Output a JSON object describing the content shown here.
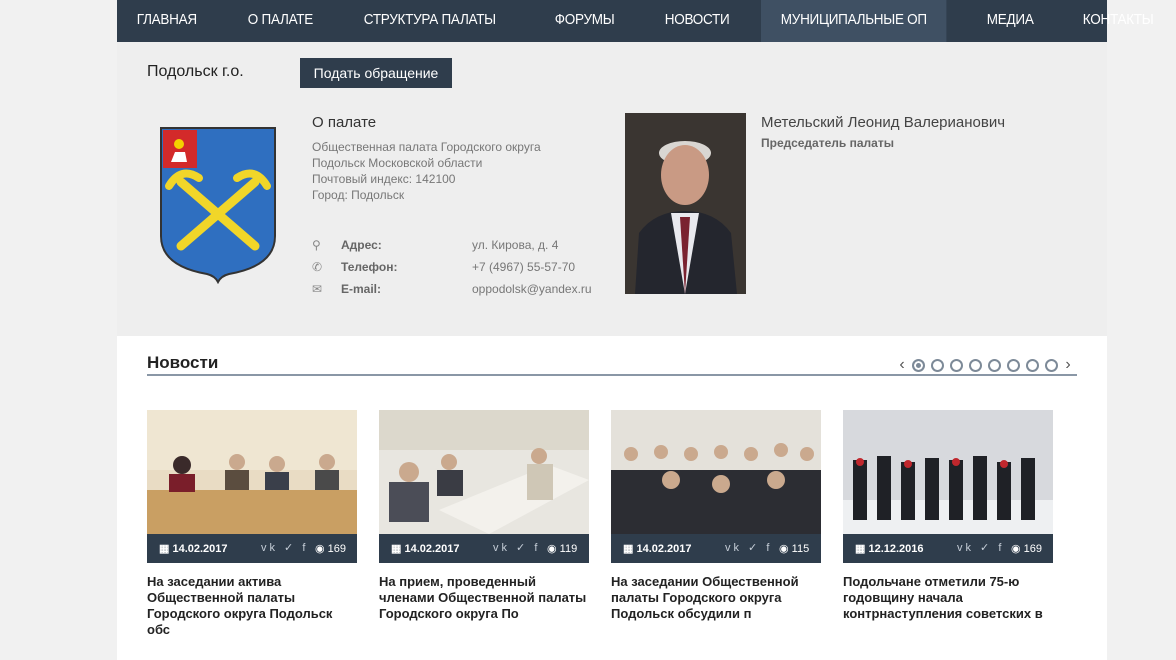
{
  "nav": {
    "items": [
      "ГЛАВНАЯ",
      "О ПАЛАТЕ",
      "СТРУКТУРА ПАЛАТЫ",
      "ФОРУМЫ",
      "НОВОСТИ",
      "МУНИЦИПАЛЬНЫЕ ОП",
      "МЕДИА",
      "КОНТАКТЫ"
    ],
    "active_index": 5
  },
  "header": {
    "city": "Подольск г.о.",
    "appeal_button": "Подать обращение"
  },
  "about": {
    "title": "О палате",
    "lines": [
      "Общественная палата Городского округа",
      "Подольск Московской области",
      "Почтовый индекс: 142100",
      "Город: Подольск"
    ]
  },
  "contacts": {
    "address_label": "Адрес:",
    "address_value": "ул. Кирова, д. 4",
    "phone_label": "Телефон:",
    "phone_value": "+7 (4967) 55-57-70",
    "email_label": "E-mail:",
    "email_value": "oppodolsk@yandex.ru",
    "icons": [
      "map-marker-icon",
      "phone-icon",
      "envelope-icon"
    ]
  },
  "chairman": {
    "name": "Метельский Леонид Валерианович",
    "role": "Председатель палаты"
  },
  "news": {
    "title": "Новости",
    "pager": {
      "total": 8,
      "active": 0
    },
    "social_icons": [
      "vk-icon",
      "twitter-icon",
      "facebook-icon"
    ],
    "items": [
      {
        "date": "14.02.2017",
        "views": "169",
        "title": "На заседании актива Общественной палаты Городского округа Подольск обс"
      },
      {
        "date": "14.02.2017",
        "views": "119",
        "title": "На прием, проведенный членами Общественной палаты Городского округа По"
      },
      {
        "date": "14.02.2017",
        "views": "115",
        "title": "На заседании Общественной палаты Городского округа Подольск обсудили п"
      },
      {
        "date": "12.12.2016",
        "views": "169",
        "title": "Подольчане отметили 75-ю годовщину начала контрнаступления советских в"
      }
    ]
  },
  "colors": {
    "nav_bg": "#2f3d4c",
    "nav_active": "#3f5063",
    "accent": "#2f3d4c"
  }
}
